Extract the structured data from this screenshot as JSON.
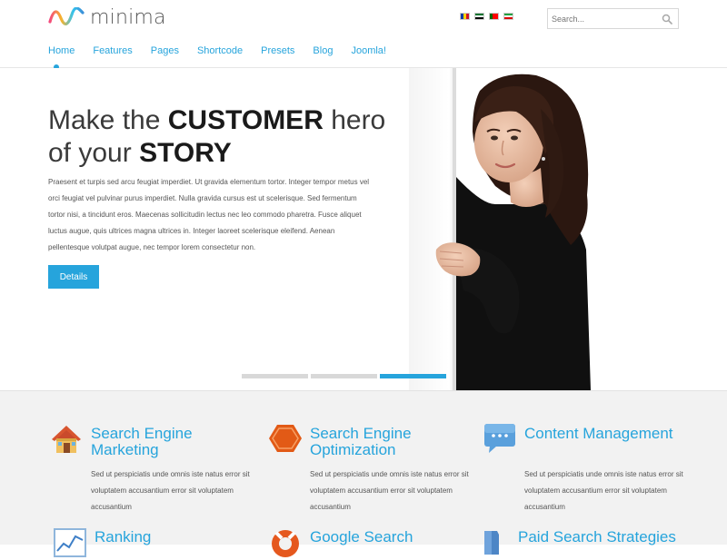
{
  "brand": {
    "name": "minima",
    "logo_colors": [
      "#f44a7e",
      "#f7b42c",
      "#34c3ee",
      "#3a8fd8"
    ]
  },
  "nav": {
    "items": [
      {
        "label": "Home",
        "active": true
      },
      {
        "label": "Features"
      },
      {
        "label": "Pages"
      },
      {
        "label": "Shortcode"
      },
      {
        "label": "Presets"
      },
      {
        "label": "Blog"
      },
      {
        "label": "Joomla!"
      }
    ]
  },
  "languages": [
    {
      "flag": "flag-icon-1",
      "colors": [
        "#003da5",
        "#ffd200",
        "#cf142b"
      ]
    },
    {
      "flag": "flag-icon-2",
      "colors": [
        "#00732f",
        "#ffffff",
        "#000000"
      ]
    },
    {
      "flag": "flag-icon-3",
      "colors": [
        "#006600",
        "#ff0000",
        "#ff0000"
      ]
    },
    {
      "flag": "flag-icon-4",
      "colors": [
        "#239f40",
        "#ffffff",
        "#da0000"
      ]
    }
  ],
  "search": {
    "placeholder": "Search..."
  },
  "hero": {
    "title_line1_pre": "Make the ",
    "title_line1_bold": "CUSTOMER",
    "title_line1_post": " hero",
    "title_line2_pre": "of your ",
    "title_line2_bold": "STORY",
    "body": "Praesent et turpis sed arcu feugiat imperdiet. Ut gravida elementum tortor. Integer tempor metus vel orci feugiat vel pulvinar purus imperdiet. Nulla gravida cursus est ut scelerisque. Sed fermentum tortor nisi, a tincidunt eros. Maecenas sollicitudin lectus nec leo commodo pharetra. Fusce aliquet luctus augue, quis ultrices magna ultrices in. Integer laoreet scelerisque eleifend. Aenean pellentesque volutpat augue, nec tempor lorem consectetur non.",
    "button_label": "Details",
    "slides_active_index": 2
  },
  "features": [
    {
      "icon": "house-icon",
      "title": "Search Engine Marketing",
      "text": "Sed ut perspiciatis unde omnis iste natus error sit voluptatem accusantium error sit voluptatem accusantium"
    },
    {
      "icon": "hexagon-icon",
      "title": "Search Engine Optimization",
      "text": "Sed ut perspiciatis unde omnis iste natus error sit voluptatem accusantium error sit voluptatem accusantium"
    },
    {
      "icon": "speech-bubble-icon",
      "title": "Content Management",
      "text": "Sed ut perspiciatis unde omnis iste natus error sit voluptatem accusantium error sit voluptatem accusantium"
    },
    {
      "icon": "chart-icon",
      "title": "Ranking"
    },
    {
      "icon": "lifebuoy-icon",
      "title": "Google Search"
    },
    {
      "icon": "shield-icon",
      "title": "Paid Search Strategies"
    }
  ],
  "accent_color": "#26a4dc"
}
